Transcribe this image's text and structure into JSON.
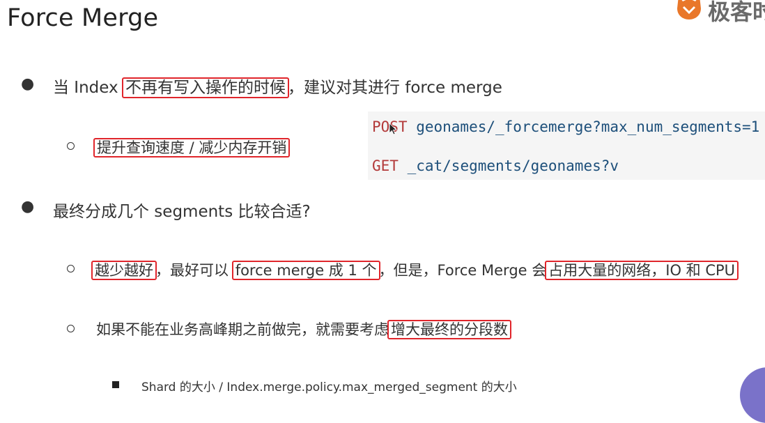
{
  "slide": {
    "title": "Force Merge",
    "brand_text": "极客时",
    "bullets": [
      {
        "id": "b1",
        "parts": [
          "当 Index ",
          "不再有写入操作的时候",
          "，建议对其进行 force merge"
        ]
      },
      {
        "id": "b1a",
        "parts": [
          "提升查询速度 / 减少内存开销"
        ]
      },
      {
        "id": "b2",
        "parts": [
          "最终分成几个 segments 比较合适?"
        ]
      },
      {
        "id": "b2a",
        "parts": [
          "越少越好",
          "，最好可以 ",
          "force merge 成 1 个",
          "，但是，Force Merge 会",
          "占用大量的网络，IO 和 CPU"
        ]
      },
      {
        "id": "b2b",
        "parts": [
          "如果不能在业务高峰期之前做完，就需要考虑",
          "增大最终的分段数"
        ]
      },
      {
        "id": "b2b1",
        "parts": [
          "Shard 的大小 /  Index.merge.policy.max_merged_segment 的大小"
        ]
      }
    ],
    "code": {
      "line1_method": "POST",
      "line1_path": " geonames/_forcemerge?max_num_segments=1",
      "line2_method": "GET",
      "line2_path": " _cat/segments/geonames?v"
    }
  },
  "colors": {
    "highlight_border": "#e0252b",
    "code_bg": "#f5f5f5",
    "code_method": "#b33a3a",
    "code_path": "#1d4f7a",
    "brand_icon": "#e9772a",
    "avatar": "#7a72c9"
  },
  "icons": {
    "brand": "geek-time-logo-icon",
    "cursor": "mouse-pointer-icon"
  }
}
